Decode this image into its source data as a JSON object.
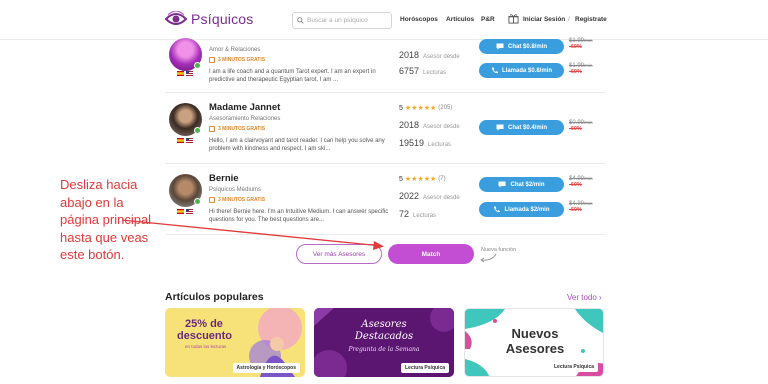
{
  "header": {
    "brand": "Psíquicos",
    "search_placeholder": "Buscar a un psíquico",
    "nav": [
      "Horóscopos",
      "Artículos",
      "P&R"
    ],
    "login": "Iniciar Sesión",
    "separator": "/",
    "register": "Registrate",
    "brand_color": "#7a2c8f"
  },
  "advisors": [
    {
      "name": "",
      "category": "Amor & Relaciones",
      "free_minutes": "3 MINUTOS GRATIS",
      "bio": "I am a life coach and a quantum Tarot expert. I am an expert in predictive and therapeutic Egyptian tarot, I am ...",
      "since_year": "2018",
      "since_label": "Asesor desde",
      "readings": "6757",
      "readings_label": "Lecturas",
      "chat_label": "Chat $0.8/min",
      "call_label": "Llamada $0.8/min",
      "chat_old_price": "$1.99",
      "call_old_price": "$1.99",
      "unit": "/min",
      "discount": "-60%"
    },
    {
      "name": "Madame Jannet",
      "category": "Asesoramiento Relaciones",
      "free_minutes": "3 MINUTOS GRATIS",
      "rating": "5",
      "reviews": "(205)",
      "bio": "Hello, I am a clairvoyant and tarot reader. I can help you solve any problem with kindness and respect. I am ski...",
      "since_year": "2018",
      "since_label": "Asesor desde",
      "readings": "19519",
      "readings_label": "Lecturas",
      "chat_label": "Chat $0.4/min",
      "chat_old_price": "$0.99",
      "unit": "/min",
      "discount": "-60%"
    },
    {
      "name": "Bernie",
      "category": "Psíquicos Médiums",
      "free_minutes": "3 MINUTOS GRATIS",
      "rating": "5",
      "reviews": "(7)",
      "bio": "Hi there! Bernie here. I'm an Intuitive Medium. I can answer specific questions for you. The best questions are...",
      "since_year": "2022",
      "since_label": "Asesor desde",
      "readings": "72",
      "readings_label": "Lecturas",
      "chat_label": "Chat $2/min",
      "call_label": "Llamada $2/min",
      "chat_old_price": "$4.99",
      "call_old_price": "$4.99",
      "unit": "/min",
      "discount": "-60%"
    }
  ],
  "stars": "★★★★★",
  "actions": {
    "more_label": "Ver más Asesores",
    "match_label": "Match",
    "new_feature": "Nueva función",
    "match_color": "#c34dd3"
  },
  "annotation": {
    "text": "Desliza hacia abajo en la página principal hasta que veas este botón.",
    "color": "#e03a3a"
  },
  "articles": {
    "title": "Artículos populares",
    "see_all": "Ver todo",
    "cards": [
      {
        "headline_1": "25% de",
        "headline_2": "descuento",
        "sub": "en todas las lecturas",
        "tag": "Astrología y Horóscopos"
      },
      {
        "headline_1": "Asesores",
        "headline_2": "Destacados",
        "sub": "Pregunta de la Semana",
        "tag": "Lectura Psíquica"
      },
      {
        "headline_1": "Nuevos",
        "headline_2": "Asesores",
        "tag": "Lectura Psíquica"
      }
    ]
  }
}
